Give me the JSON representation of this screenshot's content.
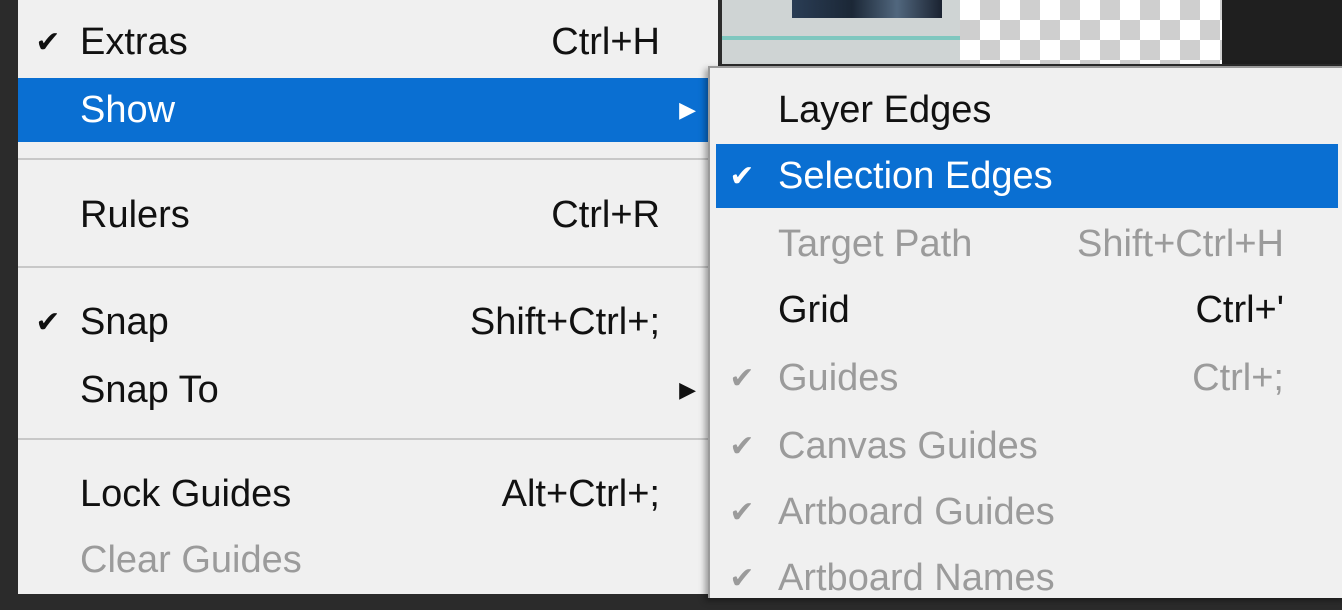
{
  "main_menu": {
    "items": [
      {
        "label": "Extras",
        "shortcut": "Ctrl+H",
        "checked": "✔"
      },
      {
        "label": "Show",
        "shortcut": "",
        "submenu_arrow": "▶"
      },
      {
        "label": "Rulers",
        "shortcut": "Ctrl+R"
      },
      {
        "label": "Snap",
        "shortcut": "Shift+Ctrl+;",
        "checked": "✔"
      },
      {
        "label": "Snap To",
        "shortcut": "",
        "submenu_arrow": "▶"
      },
      {
        "label": "Lock Guides",
        "shortcut": "Alt+Ctrl+;"
      },
      {
        "label": "Clear Guides",
        "shortcut": ""
      }
    ]
  },
  "show_submenu": {
    "items": [
      {
        "label": "Layer Edges",
        "shortcut": ""
      },
      {
        "label": "Selection Edges",
        "shortcut": "",
        "checked": "✔"
      },
      {
        "label": "Target Path",
        "shortcut": "Shift+Ctrl+H"
      },
      {
        "label": "Grid",
        "shortcut": "Ctrl+'"
      },
      {
        "label": "Guides",
        "shortcut": "Ctrl+;",
        "checked": "✔"
      },
      {
        "label": "Canvas Guides",
        "shortcut": "",
        "checked": "✔"
      },
      {
        "label": "Artboard Guides",
        "shortcut": "",
        "checked": "✔"
      },
      {
        "label": "Artboard Names",
        "shortcut": "",
        "checked": "✔"
      }
    ]
  },
  "colors": {
    "highlight": "#0a6fd2",
    "menu_bg": "#f0f0f0",
    "disabled_text": "#9b9b9b"
  }
}
